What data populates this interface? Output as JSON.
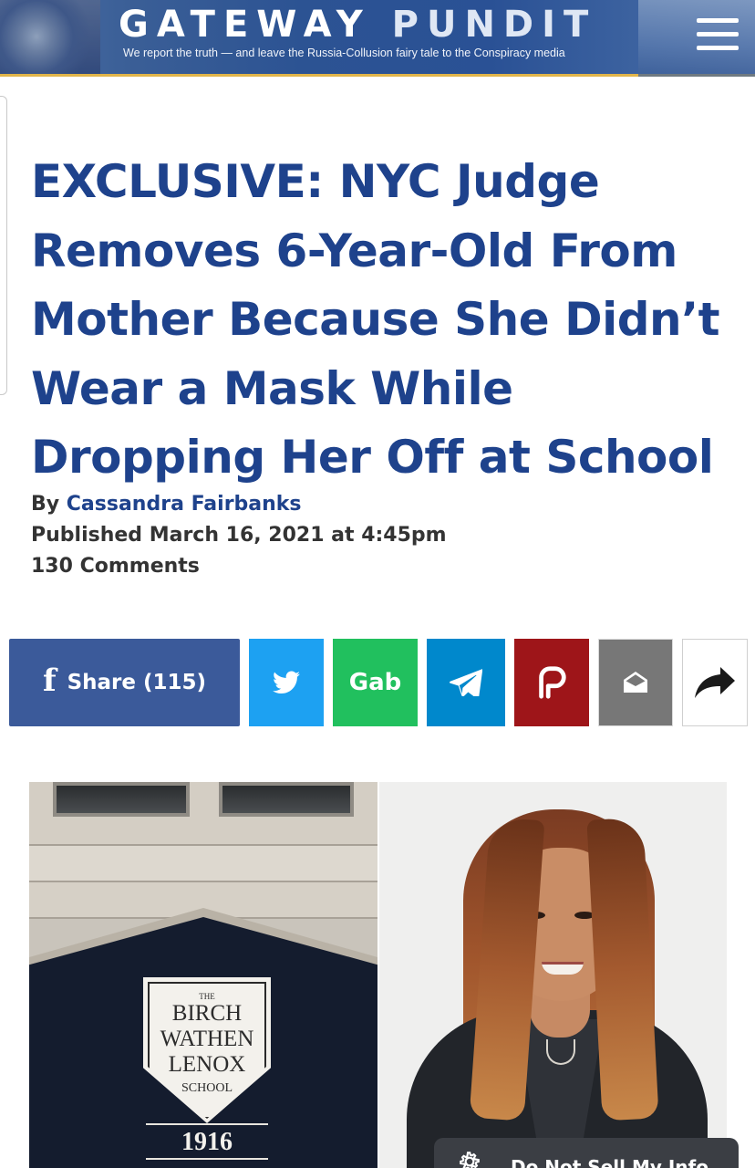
{
  "header": {
    "logo_part1": "GATEWAY",
    "logo_part2": "PUNDIT",
    "tagline": "We report the truth — and leave the Russia-Collusion fairy tale to the Conspiracy media",
    "menu_icon": "hamburger-menu-icon",
    "accent_color": "#e1b54a",
    "brand_color": "#2c5393"
  },
  "article": {
    "headline": "EXCLUSIVE: NYC Judge Removes 6-Year-Old From Mother Because She Didn’t Wear a Mask While Dropping Her Off at School",
    "by_label": "By",
    "author": "Cassandra Fairbanks",
    "published": "Published March 16, 2021 at 4:45pm",
    "comments": "130 Comments",
    "headline_color": "#1e428c"
  },
  "share": {
    "facebook_label": "Share (115)",
    "gab_label": "Gab",
    "buttons": [
      {
        "name": "facebook",
        "icon": "facebook-f-icon",
        "color": "#3b5a9a"
      },
      {
        "name": "twitter",
        "icon": "twitter-bird-icon",
        "color": "#1da1f2"
      },
      {
        "name": "gab",
        "icon": "gab-text",
        "color": "#21c05e"
      },
      {
        "name": "telegram",
        "icon": "telegram-plane-icon",
        "color": "#0088cc"
      },
      {
        "name": "parler",
        "icon": "parler-p-icon",
        "color": "#9e1519"
      },
      {
        "name": "email",
        "icon": "envelope-open-icon",
        "color": "#777777"
      },
      {
        "name": "more",
        "icon": "share-arrow-icon",
        "color": "#ffffff"
      }
    ]
  },
  "hero": {
    "school_sign": {
      "the": "THE",
      "line1": "BIRCH",
      "line2": "WATHEN",
      "line3": "LENOX",
      "line4": "SCHOOL",
      "year": "1916"
    }
  },
  "cookie_banner": {
    "icon": "gear-icon",
    "text": "Do Not Sell My Info"
  }
}
